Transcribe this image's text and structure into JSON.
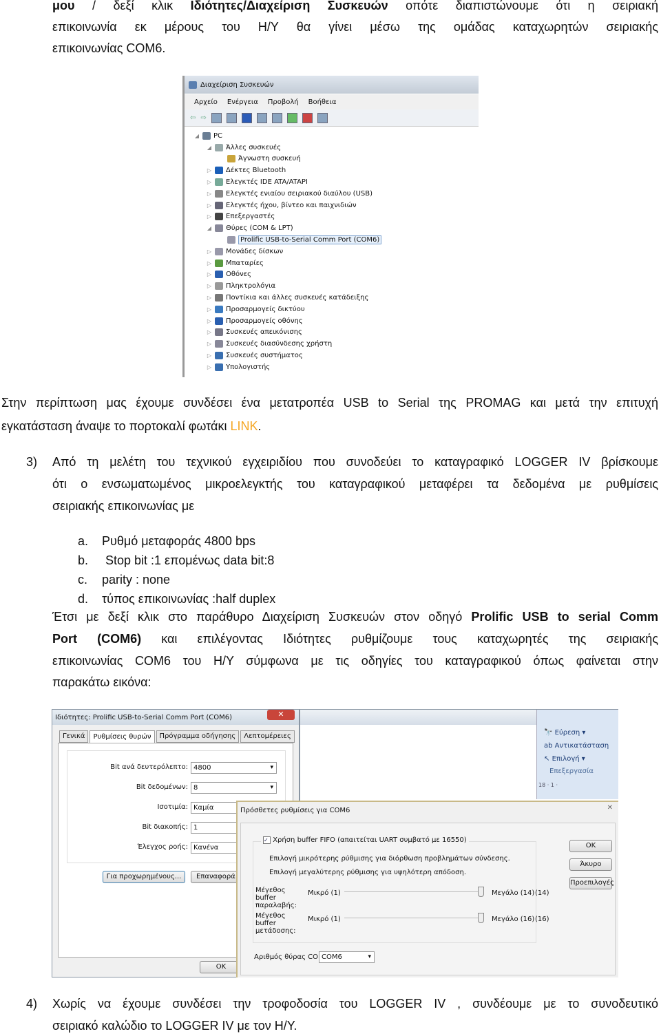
{
  "para1": {
    "l1": [
      "μου",
      "/ δεξί κλικ",
      "Ιδιότητες/Διαχείριση Συσκευών",
      "οπότε διαπιστώνουμε ότι η σειριακή"
    ],
    "l2": "επικοινωνία εκ μέρους του Η/Υ θα γίνει μέσω της ομάδας καταχωρητών σειριακής",
    "l3": "επικοινωνίας COM6."
  },
  "device_manager": {
    "title": "Διαχείριση Συσκευών",
    "menu": [
      "Αρχείο",
      "Ενέργεια",
      "Προβολή",
      "Βοήθεια"
    ],
    "tree": [
      "PC",
      "Άλλες συσκευές",
      "Άγνωστη συσκευή",
      "Δέκτες Bluetooth",
      "Ελεγκτές IDE ATA/ATAPI",
      "Ελεγκτές ενιαίου σειριακού διαύλου (USB)",
      "Ελεγκτές ήχου, βίντεο και παιχνιδιών",
      "Επεξεργαστές",
      "Θύρες (COM & LPT)",
      "Prolific USB-to-Serial Comm Port (COM6)",
      "Μονάδες δίσκων",
      "Μπαταρίες",
      "Οθόνες",
      "Πληκτρολόγια",
      "Ποντίκια και άλλες συσκευές κατάδειξης",
      "Προσαρμογείς δικτύου",
      "Προσαρμογείς οθόνης",
      "Συσκευές απεικόνισης",
      "Συσκευές διασύνδεσης χρήστη",
      "Συσκευές συστήματος",
      "Υπολογιστής"
    ]
  },
  "para2": {
    "l1": "Στην περίπτωση μας έχουμε συνδέσει ένα μετατροπέα USB to Serial της PROMAG και μετά την επιτυχή",
    "l2": "εγκατάσταση άναψε το πορτοκαλί φωτάκι",
    "link": "LINK",
    "l2end": "."
  },
  "item3": {
    "num": "3)",
    "l1": "Από τη μελέτη του τεχνικού εγχειριδίου που συνοδεύει το καταγραφικό LOGGER IV βρίσκουμε",
    "l2": "ότι ο ενσωματωμένος μικροελεγκτής του καταγραφικού  μεταφέρει τα δεδομένα με ρυθμίσεις",
    "l3": "σειριακής επικοινωνίας με",
    "list": [
      {
        "m": "a.",
        "t": "Ρυθμό μεταφοράς 4800 bps"
      },
      {
        "m": "b.",
        "t": " Stop bit :1 επομένως data bit:8"
      },
      {
        "m": "c.",
        "t": "parity : none"
      },
      {
        "m": "d.",
        "t": "τύπος επικοινωνίας :half duplex"
      }
    ]
  },
  "para3": {
    "l1": [
      "Έτσι με δεξί κλικ στο παράθυρο Διαχείριση Συσκευών στον οδηγό",
      "Prolific USB to serial Comm"
    ],
    "l2": [
      "Port (COM6)",
      "και επιλέγοντας Ιδιότητες ρυθμίζουμε τους καταχωρητές της σειριακής"
    ],
    "l3": "επικοινωνίας COM6 του Η/Υ σύμφωνα με τις οδηγίες του καταγραφικού όπως φαίνεται στην",
    "l4": "παρακάτω εικόνα:"
  },
  "props": {
    "title": "Ιδιότητες: Prolific USB-to-Serial Comm Port (COM6)",
    "tabs": [
      "Γενικά",
      "Ρυθμίσεις θυρών",
      "Πρόγραμμα οδήγησης",
      "Λεπτομέρειες"
    ],
    "fields": [
      {
        "label": "Bit ανά δευτερόλεπτο:",
        "value": "4800"
      },
      {
        "label": "Bit δεδομένων:",
        "value": "8"
      },
      {
        "label": "Ισοτιμία:",
        "value": "Καμία"
      },
      {
        "label": "Bit διακοπής:",
        "value": "1"
      },
      {
        "label": "Έλεγχος ροής:",
        "value": "Κανένα"
      }
    ],
    "advanced": "Για προχωρημένους...",
    "restore": "Επαναφορά π",
    "ok": "OK"
  },
  "ribbon": {
    "find": "Εύρεση",
    "replace": "Αντικατάσταση",
    "select": "Επιλογή",
    "group": "Επεξεργασία",
    "ruler": "18 · 1 ·"
  },
  "adv": {
    "title": "Πρόσθετες ρυθμίσεις για COM6",
    "fifo": "Χρήση buffer FIFO (απαιτείται UART συμβατό με 16550)",
    "fifo_checked": true,
    "hint1": "Επιλογή μικρότερης ρύθμισης για διόρθωση προβλημάτων σύνδεσης.",
    "hint2": "Επιλογή μεγαλύτερης ρύθμισης για υψηλότερη απόδοση.",
    "rx": {
      "label": "Μέγεθος buffer παραλαβής:",
      "min": "Μικρό (1)",
      "max": "Μεγάλο (14)",
      "value": "(14)"
    },
    "tx": {
      "label": "Μέγεθος buffer μετάδοσης:",
      "min": "Μικρό (1)",
      "max": "Μεγάλο (16)",
      "value": "(16)"
    },
    "com_label": "Αριθμός θύρας COM:",
    "com": "COM6",
    "ok": "OK",
    "cancel": "Άκυρο",
    "defaults": "Προεπιλογές"
  },
  "item4": {
    "num": "4)",
    "l1": "Χωρίς να έχουμε συνδέσει την τροφοδοσία του LOGGER IV , συνδέουμε με το συνοδευτικό",
    "l2": "σειριακό καλώδιο το LOGGER IV με τον Η/Υ."
  }
}
